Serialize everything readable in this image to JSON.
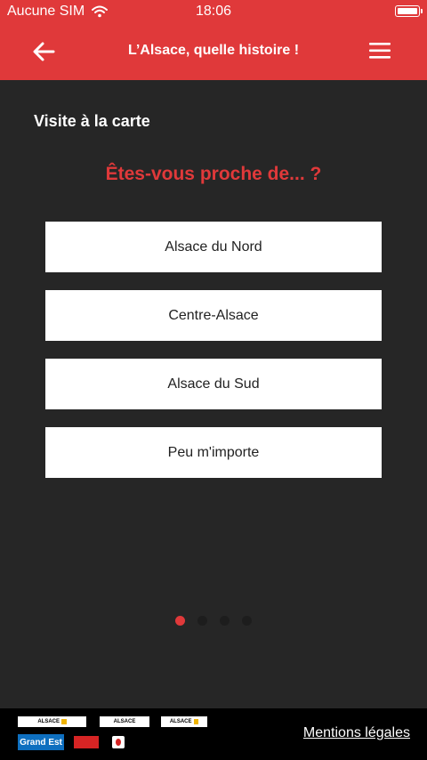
{
  "status_bar": {
    "carrier": "Aucune SIM",
    "time": "18:06"
  },
  "nav_bar": {
    "title": "L’Alsace, quelle histoire !",
    "back_icon": "arrow-left-icon",
    "menu_icon": "hamburger-menu-icon"
  },
  "content": {
    "section_title": "Visite à la carte",
    "question": "Êtes-vous proche de... ?",
    "options": [
      {
        "label": "Alsace du Nord"
      },
      {
        "label": "Centre-Alsace"
      },
      {
        "label": "Alsace du Sud"
      },
      {
        "label": "Peu m'importe"
      }
    ]
  },
  "pagination": {
    "total_pages": 4,
    "current_page": 1
  },
  "footer": {
    "logos": {
      "alsace_label": "ALSACE",
      "grand_est_label": "Grand Est"
    },
    "legal_link": "Mentions légales"
  },
  "colors": {
    "accent": "#e0393a",
    "background": "#262626",
    "footer": "#000000"
  }
}
